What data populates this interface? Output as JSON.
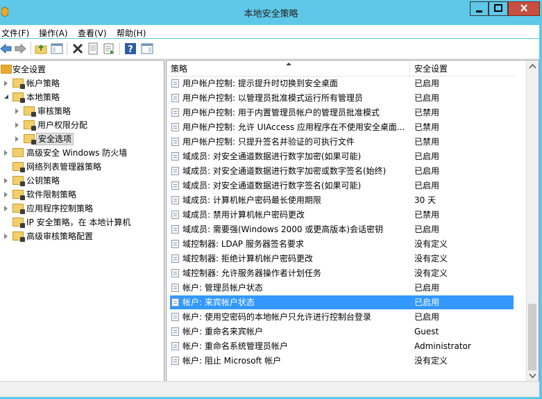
{
  "window": {
    "title": "本地安全策略",
    "minimize_label": "",
    "maximize_label": "",
    "close_label": ""
  },
  "menu": [
    {
      "label": "文件(F)"
    },
    {
      "label": "操作(A)"
    },
    {
      "label": "查看(V)"
    },
    {
      "label": "帮助(H)"
    }
  ],
  "toolbar": {
    "icons": [
      "back-arrow-icon",
      "forward-arrow-icon",
      "up-folder-icon",
      "show-hide-tree-icon",
      "delete-icon",
      "properties-icon",
      "export-list-icon",
      "help-icon",
      "show-action-pane-icon"
    ]
  },
  "tree": {
    "root": "安全设置",
    "items": [
      {
        "label": "帐户策略",
        "level": 1,
        "expanded": false
      },
      {
        "label": "本地策略",
        "level": 1,
        "expanded": true
      },
      {
        "label": "审核策略",
        "level": 2,
        "expanded": false
      },
      {
        "label": "用户权限分配",
        "level": 2,
        "expanded": false
      },
      {
        "label": "安全选项",
        "level": 2,
        "expanded": false,
        "selected": true
      },
      {
        "label": "高级安全 Windows 防火墙",
        "level": 1,
        "expanded": false
      },
      {
        "label": "网络列表管理器策略",
        "level": 1,
        "expanded": null
      },
      {
        "label": "公钥策略",
        "level": 1,
        "expanded": false
      },
      {
        "label": "软件限制策略",
        "level": 1,
        "expanded": false
      },
      {
        "label": "应用程序控制策略",
        "level": 1,
        "expanded": false
      },
      {
        "label": "IP 安全策略，在 本地计算机",
        "level": 1,
        "expanded": null
      },
      {
        "label": "高级审核策略配置",
        "level": 1,
        "expanded": false
      }
    ]
  },
  "table": {
    "columns": {
      "policy": "策略",
      "setting": "安全设置"
    },
    "rows": [
      {
        "policy": "用户帐户控制: 提示提升时切换到安全桌面",
        "setting": "已启用"
      },
      {
        "policy": "用户帐户控制: 以管理员批准模式运行所有管理员",
        "setting": "已启用"
      },
      {
        "policy": "用户帐户控制: 用于内置管理员帐户的管理员批准模式",
        "setting": "已禁用"
      },
      {
        "policy": "用户帐户控制: 允许 UIAccess 应用程序在不使用安全桌面...",
        "setting": "已禁用"
      },
      {
        "policy": "用户帐户控制: 只提升签名并验证的可执行文件",
        "setting": "已禁用"
      },
      {
        "policy": "域成员: 对安全通道数据进行数字加密(如果可能)",
        "setting": "已启用"
      },
      {
        "policy": "域成员: 对安全通道数据进行数字加密或数字签名(始终)",
        "setting": "已启用"
      },
      {
        "policy": "域成员: 对安全通道数据进行数字签名(如果可能)",
        "setting": "已启用"
      },
      {
        "policy": "域成员: 计算机帐户密码最长使用期限",
        "setting": "30 天"
      },
      {
        "policy": "域成员: 禁用计算机帐户密码更改",
        "setting": "已禁用"
      },
      {
        "policy": "域成员: 需要强(Windows 2000 或更高版本)会话密钥",
        "setting": "已启用"
      },
      {
        "policy": "域控制器: LDAP 服务器签名要求",
        "setting": "没有定义"
      },
      {
        "policy": "域控制器: 拒绝计算机帐户密码更改",
        "setting": "没有定义"
      },
      {
        "policy": "域控制器: 允许服务器操作者计划任务",
        "setting": "没有定义"
      },
      {
        "policy": "帐户: 管理员帐户状态",
        "setting": "已启用"
      },
      {
        "policy": "帐户: 来宾帐户状态",
        "setting": "已启用",
        "selected": true
      },
      {
        "policy": "帐户: 使用空密码的本地帐户只允许进行控制台登录",
        "setting": "已启用"
      },
      {
        "policy": "帐户: 重命名来宾帐户",
        "setting": "Guest"
      },
      {
        "policy": "帐户: 重命名系统管理员帐户",
        "setting": "Administrator"
      },
      {
        "policy": "帐户: 阻止 Microsoft 帐户",
        "setting": "没有定义"
      }
    ]
  },
  "colors": {
    "title_bar": "#5fc8e8",
    "selection": "#3399ff",
    "close_button": "#c74f3f"
  }
}
